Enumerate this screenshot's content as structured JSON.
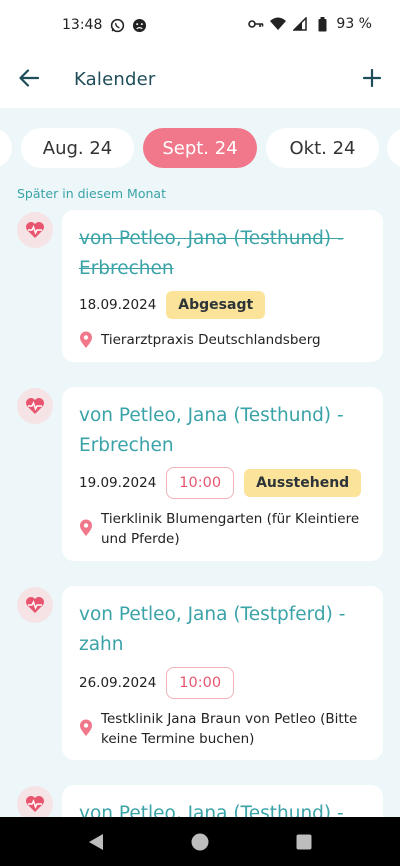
{
  "status_bar": {
    "time": "13:48",
    "battery": "93 %"
  },
  "app_bar": {
    "title": "Kalender"
  },
  "months": [
    {
      "label": "Aug. 24",
      "active": false
    },
    {
      "label": "Sept. 24",
      "active": true
    },
    {
      "label": "Okt. 24",
      "active": false
    }
  ],
  "section_label": "Später in diesem Monat",
  "appointments": [
    {
      "title_line1": "von Petleo, Jana (Testhund) -",
      "title_line2": "Erbrechen",
      "date": "18.09.2024",
      "time": "",
      "status": "Abgesagt",
      "location_line1": "Tierarztpraxis Deutschlandsberg",
      "location_line2": ""
    },
    {
      "title_line1": "von Petleo, Jana (Testhund) -",
      "title_line2": "Erbrechen",
      "date": "19.09.2024",
      "time": "10:00",
      "status": "Ausstehend",
      "location_line1": "Tierklinik Blumengarten (für Kleintiere",
      "location_line2": "und Pferde)"
    },
    {
      "title_line1": "von Petleo, Jana (Testpferd) -",
      "title_line2": "zahn",
      "date": "26.09.2024",
      "time": "10:00",
      "status": "",
      "location_line1": "Testklinik Jana Braun von Petleo (Bitte",
      "location_line2": "keine Termine buchen)"
    },
    {
      "title_line1": "von Petleo, Jana (Testhund) -",
      "title_line2": "",
      "date": "",
      "time": "",
      "status": "",
      "location_line1": "",
      "location_line2": ""
    }
  ],
  "colors": {
    "accent": "#3aa3a8",
    "active_month": "#f0788a",
    "status_chip": "#fbe39a",
    "background": "#edf6f8"
  }
}
